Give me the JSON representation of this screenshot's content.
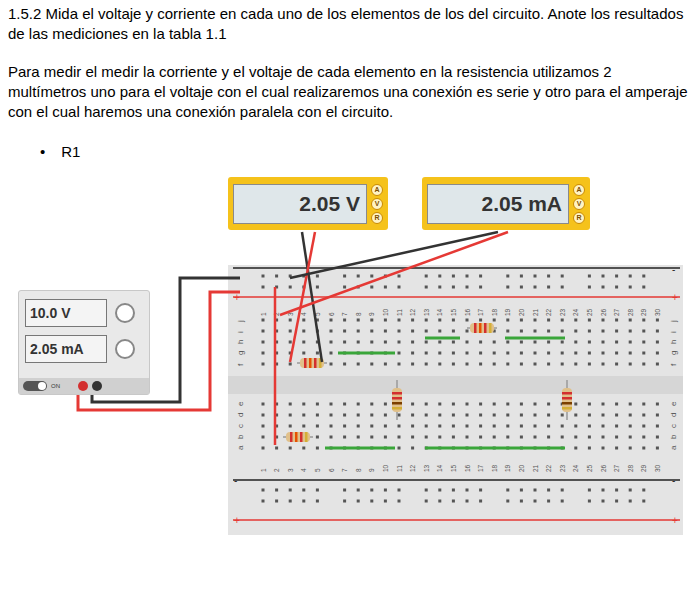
{
  "document": {
    "heading": "1.5.2 Mida el voltaje y corriente en cada uno de los elementos de los del circuito. Anote los resultados de las mediciones en la tabla 1.1",
    "paragraph": "Para medir el medir la corriente y el voltaje de cada elemento en la resistencia utilizamos 2 multímetros uno para el voltaje con el cual realizaremos una conexión es serie y otro para el amperaje con el cual haremos una conexión paralela con el circuito.",
    "bullet": {
      "marker": "•",
      "text": "R1"
    }
  },
  "circuit": {
    "voltmeter": {
      "reading": "2.05 V",
      "buttons": [
        "A",
        "V",
        "R"
      ]
    },
    "ammeter": {
      "reading": "2.05 mA",
      "buttons": [
        "A",
        "V",
        "R"
      ]
    },
    "power_supply": {
      "voltage": "10.0 V",
      "current": "2.05 mA",
      "switch_label": "ON",
      "on": true
    },
    "breadboard": {
      "columns": [
        "1",
        "2",
        "3",
        "4",
        "5",
        "6",
        "7",
        "8",
        "9",
        "10",
        "11",
        "12",
        "13",
        "14",
        "15",
        "16",
        "17",
        "18",
        "19",
        "20",
        "21",
        "22",
        "23",
        "24",
        "25",
        "26",
        "27",
        "28",
        "29",
        "30"
      ],
      "rows_top": [
        "j",
        "i",
        "h",
        "g",
        "f"
      ],
      "rows_bottom": [
        "e",
        "d",
        "c",
        "b",
        "a"
      ],
      "rail_minus": "-",
      "rail_plus": "+"
    }
  }
}
